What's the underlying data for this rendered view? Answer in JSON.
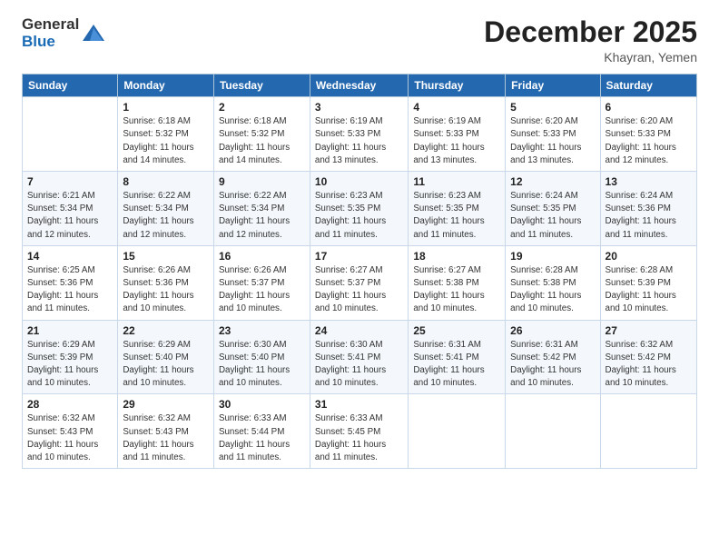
{
  "header": {
    "logo_general": "General",
    "logo_blue": "Blue",
    "month_title": "December 2025",
    "location": "Khayran, Yemen"
  },
  "weekdays": [
    "Sunday",
    "Monday",
    "Tuesday",
    "Wednesday",
    "Thursday",
    "Friday",
    "Saturday"
  ],
  "weeks": [
    [
      {
        "day": "",
        "info": ""
      },
      {
        "day": "1",
        "info": "Sunrise: 6:18 AM\nSunset: 5:32 PM\nDaylight: 11 hours\nand 14 minutes."
      },
      {
        "day": "2",
        "info": "Sunrise: 6:18 AM\nSunset: 5:32 PM\nDaylight: 11 hours\nand 14 minutes."
      },
      {
        "day": "3",
        "info": "Sunrise: 6:19 AM\nSunset: 5:33 PM\nDaylight: 11 hours\nand 13 minutes."
      },
      {
        "day": "4",
        "info": "Sunrise: 6:19 AM\nSunset: 5:33 PM\nDaylight: 11 hours\nand 13 minutes."
      },
      {
        "day": "5",
        "info": "Sunrise: 6:20 AM\nSunset: 5:33 PM\nDaylight: 11 hours\nand 13 minutes."
      },
      {
        "day": "6",
        "info": "Sunrise: 6:20 AM\nSunset: 5:33 PM\nDaylight: 11 hours\nand 12 minutes."
      }
    ],
    [
      {
        "day": "7",
        "info": "Sunrise: 6:21 AM\nSunset: 5:34 PM\nDaylight: 11 hours\nand 12 minutes."
      },
      {
        "day": "8",
        "info": "Sunrise: 6:22 AM\nSunset: 5:34 PM\nDaylight: 11 hours\nand 12 minutes."
      },
      {
        "day": "9",
        "info": "Sunrise: 6:22 AM\nSunset: 5:34 PM\nDaylight: 11 hours\nand 12 minutes."
      },
      {
        "day": "10",
        "info": "Sunrise: 6:23 AM\nSunset: 5:35 PM\nDaylight: 11 hours\nand 11 minutes."
      },
      {
        "day": "11",
        "info": "Sunrise: 6:23 AM\nSunset: 5:35 PM\nDaylight: 11 hours\nand 11 minutes."
      },
      {
        "day": "12",
        "info": "Sunrise: 6:24 AM\nSunset: 5:35 PM\nDaylight: 11 hours\nand 11 minutes."
      },
      {
        "day": "13",
        "info": "Sunrise: 6:24 AM\nSunset: 5:36 PM\nDaylight: 11 hours\nand 11 minutes."
      }
    ],
    [
      {
        "day": "14",
        "info": "Sunrise: 6:25 AM\nSunset: 5:36 PM\nDaylight: 11 hours\nand 11 minutes."
      },
      {
        "day": "15",
        "info": "Sunrise: 6:26 AM\nSunset: 5:36 PM\nDaylight: 11 hours\nand 10 minutes."
      },
      {
        "day": "16",
        "info": "Sunrise: 6:26 AM\nSunset: 5:37 PM\nDaylight: 11 hours\nand 10 minutes."
      },
      {
        "day": "17",
        "info": "Sunrise: 6:27 AM\nSunset: 5:37 PM\nDaylight: 11 hours\nand 10 minutes."
      },
      {
        "day": "18",
        "info": "Sunrise: 6:27 AM\nSunset: 5:38 PM\nDaylight: 11 hours\nand 10 minutes."
      },
      {
        "day": "19",
        "info": "Sunrise: 6:28 AM\nSunset: 5:38 PM\nDaylight: 11 hours\nand 10 minutes."
      },
      {
        "day": "20",
        "info": "Sunrise: 6:28 AM\nSunset: 5:39 PM\nDaylight: 11 hours\nand 10 minutes."
      }
    ],
    [
      {
        "day": "21",
        "info": "Sunrise: 6:29 AM\nSunset: 5:39 PM\nDaylight: 11 hours\nand 10 minutes."
      },
      {
        "day": "22",
        "info": "Sunrise: 6:29 AM\nSunset: 5:40 PM\nDaylight: 11 hours\nand 10 minutes."
      },
      {
        "day": "23",
        "info": "Sunrise: 6:30 AM\nSunset: 5:40 PM\nDaylight: 11 hours\nand 10 minutes."
      },
      {
        "day": "24",
        "info": "Sunrise: 6:30 AM\nSunset: 5:41 PM\nDaylight: 11 hours\nand 10 minutes."
      },
      {
        "day": "25",
        "info": "Sunrise: 6:31 AM\nSunset: 5:41 PM\nDaylight: 11 hours\nand 10 minutes."
      },
      {
        "day": "26",
        "info": "Sunrise: 6:31 AM\nSunset: 5:42 PM\nDaylight: 11 hours\nand 10 minutes."
      },
      {
        "day": "27",
        "info": "Sunrise: 6:32 AM\nSunset: 5:42 PM\nDaylight: 11 hours\nand 10 minutes."
      }
    ],
    [
      {
        "day": "28",
        "info": "Sunrise: 6:32 AM\nSunset: 5:43 PM\nDaylight: 11 hours\nand 10 minutes."
      },
      {
        "day": "29",
        "info": "Sunrise: 6:32 AM\nSunset: 5:43 PM\nDaylight: 11 hours\nand 11 minutes."
      },
      {
        "day": "30",
        "info": "Sunrise: 6:33 AM\nSunset: 5:44 PM\nDaylight: 11 hours\nand 11 minutes."
      },
      {
        "day": "31",
        "info": "Sunrise: 6:33 AM\nSunset: 5:45 PM\nDaylight: 11 hours\nand 11 minutes."
      },
      {
        "day": "",
        "info": ""
      },
      {
        "day": "",
        "info": ""
      },
      {
        "day": "",
        "info": ""
      }
    ]
  ]
}
